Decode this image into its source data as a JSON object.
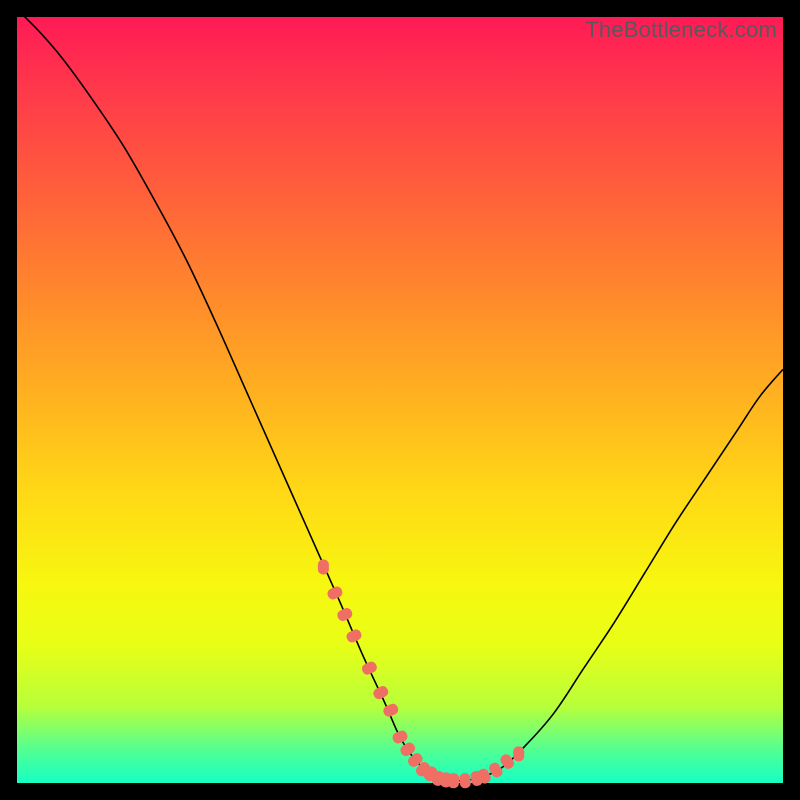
{
  "watermark": "TheBottleneck.com",
  "colors": {
    "frame": "#000000",
    "gradient_top": "#ff1a56",
    "gradient_bottom": "#16ffc4",
    "curve": "#000000",
    "dots": "#ef6f65"
  },
  "chart_data": {
    "type": "line",
    "title": "",
    "xlabel": "",
    "ylabel": "",
    "xlim": [
      0,
      100
    ],
    "ylim": [
      0,
      100
    ],
    "x": [
      0,
      3,
      6,
      10,
      14,
      18,
      22,
      26,
      30,
      34,
      38,
      42,
      45,
      48,
      50,
      52,
      54,
      55,
      56,
      58,
      60,
      63,
      66,
      70,
      74,
      78,
      82,
      86,
      90,
      94,
      97,
      100
    ],
    "values": [
      101,
      98,
      94.5,
      89,
      83,
      76,
      68.5,
      60,
      51,
      42,
      33,
      24,
      17,
      10.5,
      6,
      3,
      1.2,
      0.6,
      0.4,
      0.3,
      0.6,
      1.8,
      4.5,
      9,
      15,
      21,
      27.5,
      34,
      40,
      46,
      50.5,
      54
    ],
    "highlight_points_x": [
      40,
      41.5,
      42.8,
      44,
      46,
      47.5,
      48.8,
      50,
      51,
      52,
      53,
      54,
      55,
      56,
      57,
      58.5,
      60,
      61,
      62.5,
      64,
      65.5
    ],
    "highlight_points_y": [
      28.2,
      24.8,
      22,
      19.2,
      15,
      11.8,
      9.5,
      6,
      4.4,
      3,
      1.8,
      1.2,
      0.6,
      0.4,
      0.3,
      0.3,
      0.6,
      0.9,
      1.7,
      2.8,
      3.8
    ]
  }
}
